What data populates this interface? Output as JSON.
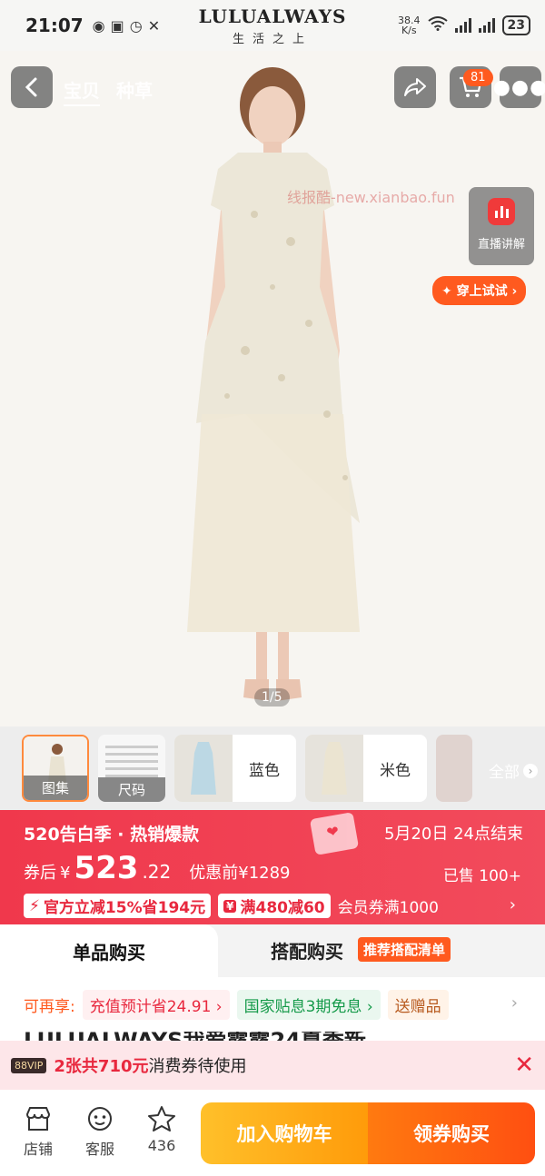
{
  "status_bar": {
    "time": "21:07",
    "brand_name": "LULUALWAYS",
    "brand_slogan": "生活之上",
    "net_speed_value": "38.4",
    "net_speed_unit": "K/s",
    "battery": "23"
  },
  "nav": {
    "tabs": [
      "宝贝",
      "种草"
    ],
    "cart_count": "81"
  },
  "hero": {
    "watermark": "线报酷-new.xianbao.fun",
    "live_label": "直播讲解",
    "tryon_label": "穿上试试",
    "counter": "1/5"
  },
  "thumbnails": {
    "items": [
      {
        "label": "图集"
      },
      {
        "label": "尺码"
      },
      {
        "label": "蓝色"
      },
      {
        "label": "米色"
      }
    ],
    "all_label": "全部"
  },
  "promo": {
    "event": "520告白季 · 热销爆款",
    "end_time": "5月20日 24点结束",
    "price_label": "券后",
    "currency": "¥",
    "price_int": "523",
    "price_dec": ".22",
    "original_label": "优惠前¥1289",
    "sold": "已售 100+",
    "tag1": "官方立减15%省194元",
    "tag2": "满480减60",
    "member": "会员券满1000"
  },
  "buy_tabs": {
    "single": "单品购买",
    "combo": "搭配购买",
    "combo_badge": "推荐搭配清单"
  },
  "benefits": {
    "label": "可再享:",
    "chips": [
      "充值预计省24.91",
      "国家贴息3期免息",
      "送赠品"
    ]
  },
  "title_peek": "LULUALWAYS我爱露露24夏季新",
  "coupon": {
    "vip": "88VIP",
    "highlight": "2张共710元",
    "text": "消费券待使用"
  },
  "bottom": {
    "store": "店铺",
    "service": "客服",
    "favorites": "436",
    "add_cart": "加入购物车",
    "buy": "领券购买"
  },
  "colors": {
    "promo_red": "#f0384c",
    "accent_orange": "#ff5a1f",
    "cart_yellow": "#ffb020"
  }
}
